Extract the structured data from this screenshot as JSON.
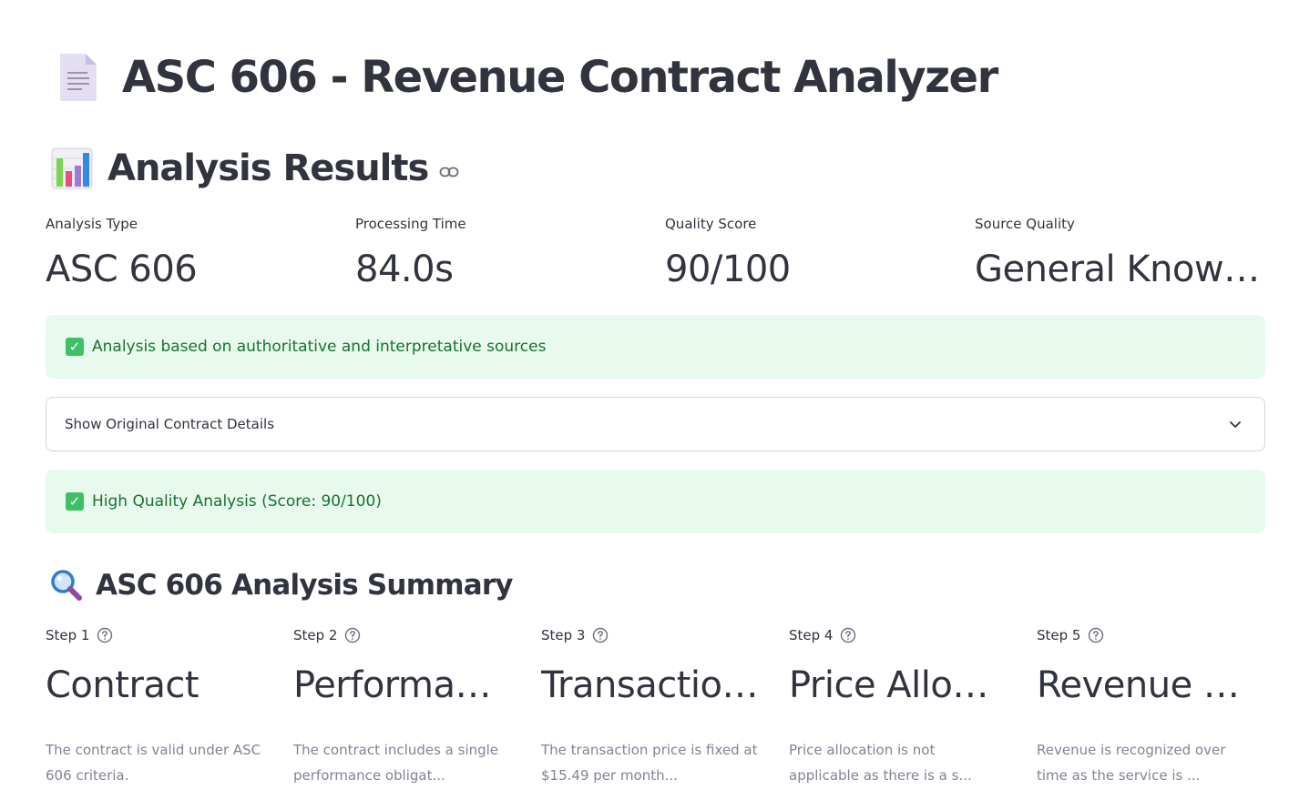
{
  "page": {
    "title": "ASC 606 - Revenue Contract Analyzer",
    "title_icon": "document-icon"
  },
  "results": {
    "heading": "Analysis Results",
    "heading_icon": "bar-chart-icon",
    "anchor_icon": "link-icon"
  },
  "metrics": [
    {
      "label": "Analysis Type",
      "value": "ASC 606"
    },
    {
      "label": "Processing Time",
      "value": "84.0s"
    },
    {
      "label": "Quality Score",
      "value": "90/100"
    },
    {
      "label": "Source Quality",
      "value": "General Knowledge"
    }
  ],
  "alerts": {
    "sources": "Analysis based on authoritative and interpretative sources",
    "quality": "High Quality Analysis (Score: 90/100)",
    "icon": "check-box-icon",
    "text_color": "#177233",
    "background": "#e8f9ee"
  },
  "expander": {
    "label": "Show Original Contract Details",
    "icon": "chevron-down-icon"
  },
  "summary": {
    "heading": "ASC 606 Analysis Summary",
    "heading_icon": "magnifier-icon",
    "steps": [
      {
        "label": "Step 1",
        "value": "Contract",
        "description": "The contract is valid under ASC 606 criteria."
      },
      {
        "label": "Step 2",
        "value": "Performance Obligations",
        "description": "The contract includes a single performance obligat..."
      },
      {
        "label": "Step 3",
        "value": "Transaction Price",
        "description": "The transaction price is fixed at $15.49 per month..."
      },
      {
        "label": "Step 4",
        "value": "Price Allocation",
        "description": "Price allocation is not applicable as there is a s..."
      },
      {
        "label": "Step 5",
        "value": "Revenue Recognition",
        "description": "Revenue is recognized over time as the service is ..."
      }
    ]
  }
}
